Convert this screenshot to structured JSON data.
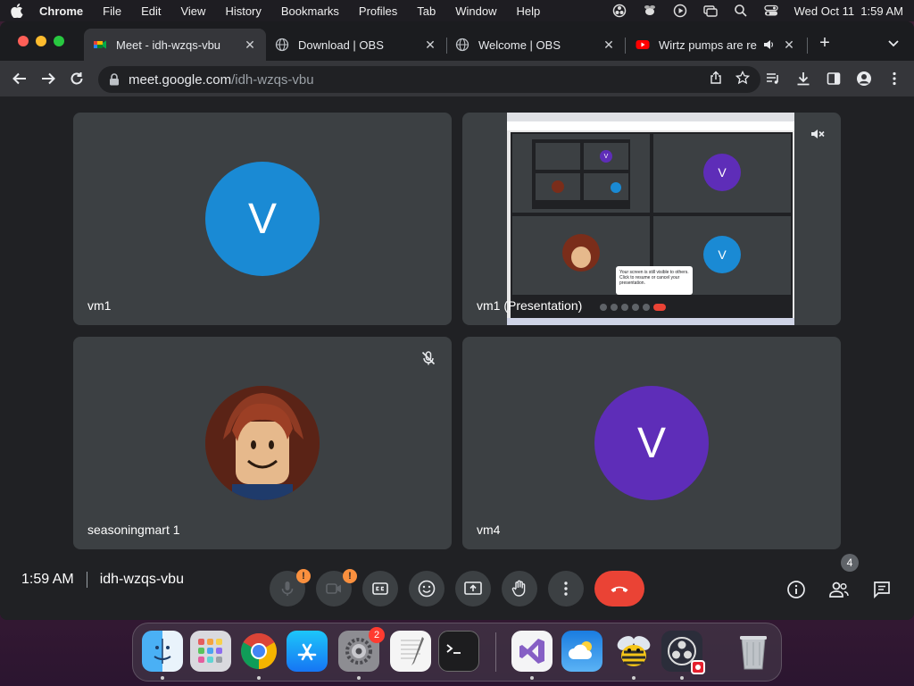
{
  "menubar": {
    "app_name": "Chrome",
    "items": [
      "File",
      "Edit",
      "View",
      "History",
      "Bookmarks",
      "Profiles",
      "Tab",
      "Window",
      "Help"
    ],
    "datetime": "Wed Oct 11  1:59 AM"
  },
  "tabs": [
    {
      "label": "Meet - idh-wzqs-vbu",
      "icon": "google-meet-icon",
      "active": true
    },
    {
      "label": "Download | OBS",
      "icon": "globe-icon",
      "active": false
    },
    {
      "label": "Welcome | OBS",
      "icon": "globe-icon",
      "active": false
    },
    {
      "label": "Wirtz pumps are rea",
      "icon": "youtube-icon",
      "active": false,
      "audio": true
    }
  ],
  "address": {
    "host": "meet.google.com",
    "path": "/idh-wzqs-vbu"
  },
  "meet": {
    "tiles": [
      {
        "name": "vm1",
        "avatar_letter": "V",
        "avatar_color": "#1a8ad4"
      },
      {
        "name": "vm1 (Presentation)",
        "muted_audio": true
      },
      {
        "name": "seasoningmart 1",
        "muted_mic": true,
        "avatar_type": "image"
      },
      {
        "name": "vm4",
        "avatar_letter": "V",
        "avatar_color": "#5e2db8"
      }
    ],
    "presentation_preview": {
      "avatar_letter": "V",
      "toast_text": "Your screen is still visible to others. Click to resume or cancel your presentation."
    },
    "bottom": {
      "time": "1:59 AM",
      "meeting_code": "idh-wzqs-vbu",
      "warn_mark": "!",
      "participant_count": "4"
    }
  },
  "dock": {
    "apps": [
      "Finder",
      "Launchpad",
      "Google Chrome",
      "App Store",
      "System Settings",
      "TextEdit",
      "Terminal",
      "Visual Studio",
      "Weather",
      "Bee",
      "OBS",
      "Trash"
    ],
    "settings_badge": "2"
  },
  "colors": {
    "meet_bg": "#202124",
    "tile_bg": "#3c4043",
    "end_call": "#ea4335",
    "warn": "#fa903e"
  }
}
